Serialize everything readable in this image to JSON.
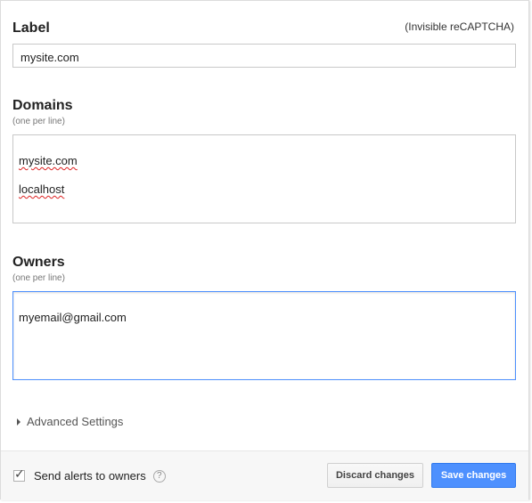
{
  "form": {
    "label_section": {
      "title": "Label",
      "type_hint": "(Invisible reCAPTCHA)",
      "value": "mysite.com"
    },
    "domains_section": {
      "title": "Domains",
      "hint": "(one per line)",
      "lines": [
        "mysite.com",
        "localhost"
      ]
    },
    "owners_section": {
      "title": "Owners",
      "hint": "(one per line)",
      "lines": [
        "myemail@gmail.com"
      ]
    },
    "advanced_settings_label": "Advanced Settings"
  },
  "footer": {
    "send_alerts_label": "Send alerts to owners",
    "send_alerts_checked": true,
    "help_icon": "help-icon",
    "discard_label": "Discard changes",
    "save_label": "Save changes"
  },
  "colors": {
    "primary_button": "#4d90fe",
    "focus_border": "#4d90fe",
    "spellcheck": "#dd2222"
  }
}
